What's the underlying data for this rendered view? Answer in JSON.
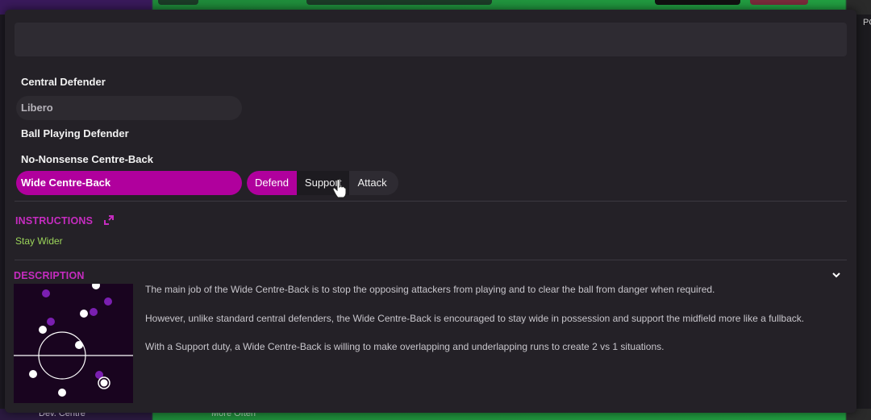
{
  "background": {
    "bottom_left_text": "Dev. Centre",
    "bottom_mid_text": "More Often",
    "right_edge_text": "POS"
  },
  "roles": [
    {
      "label": "Central Defender",
      "state": "normal"
    },
    {
      "label": "Libero",
      "state": "dim"
    },
    {
      "label": "Ball Playing Defender",
      "state": "normal"
    },
    {
      "label": "No-Nonsense Centre-Back",
      "state": "normal"
    },
    {
      "label": "Wide Centre-Back",
      "state": "selected"
    }
  ],
  "duties": [
    {
      "label": "Defend",
      "state": "selected"
    },
    {
      "label": "Support",
      "state": "hover"
    },
    {
      "label": "Attack",
      "state": "normal"
    }
  ],
  "instructions": {
    "title": "INSTRUCTIONS",
    "items": [
      "Stay Wider"
    ]
  },
  "description": {
    "title": "DESCRIPTION",
    "paragraphs": [
      "The main job of the Wide Centre-Back is to stop the opposing attackers from playing and to clear the ball from danger when required.",
      "However, unlike standard central defenders, the Wide Centre-Back is encouraged to stay wide in possession and support the midfield more like a fullback.",
      "With a Support duty, a Wide Centre-Back is willing to make overlapping and underlapping runs to create 2 vs 1 situations."
    ]
  },
  "colors": {
    "accent": "#b0009d",
    "section_title": "#c62cc0",
    "instruction_text": "#9bd45a",
    "opponent_dot": "#7a1fb0",
    "own_dot": "#ffffff"
  }
}
